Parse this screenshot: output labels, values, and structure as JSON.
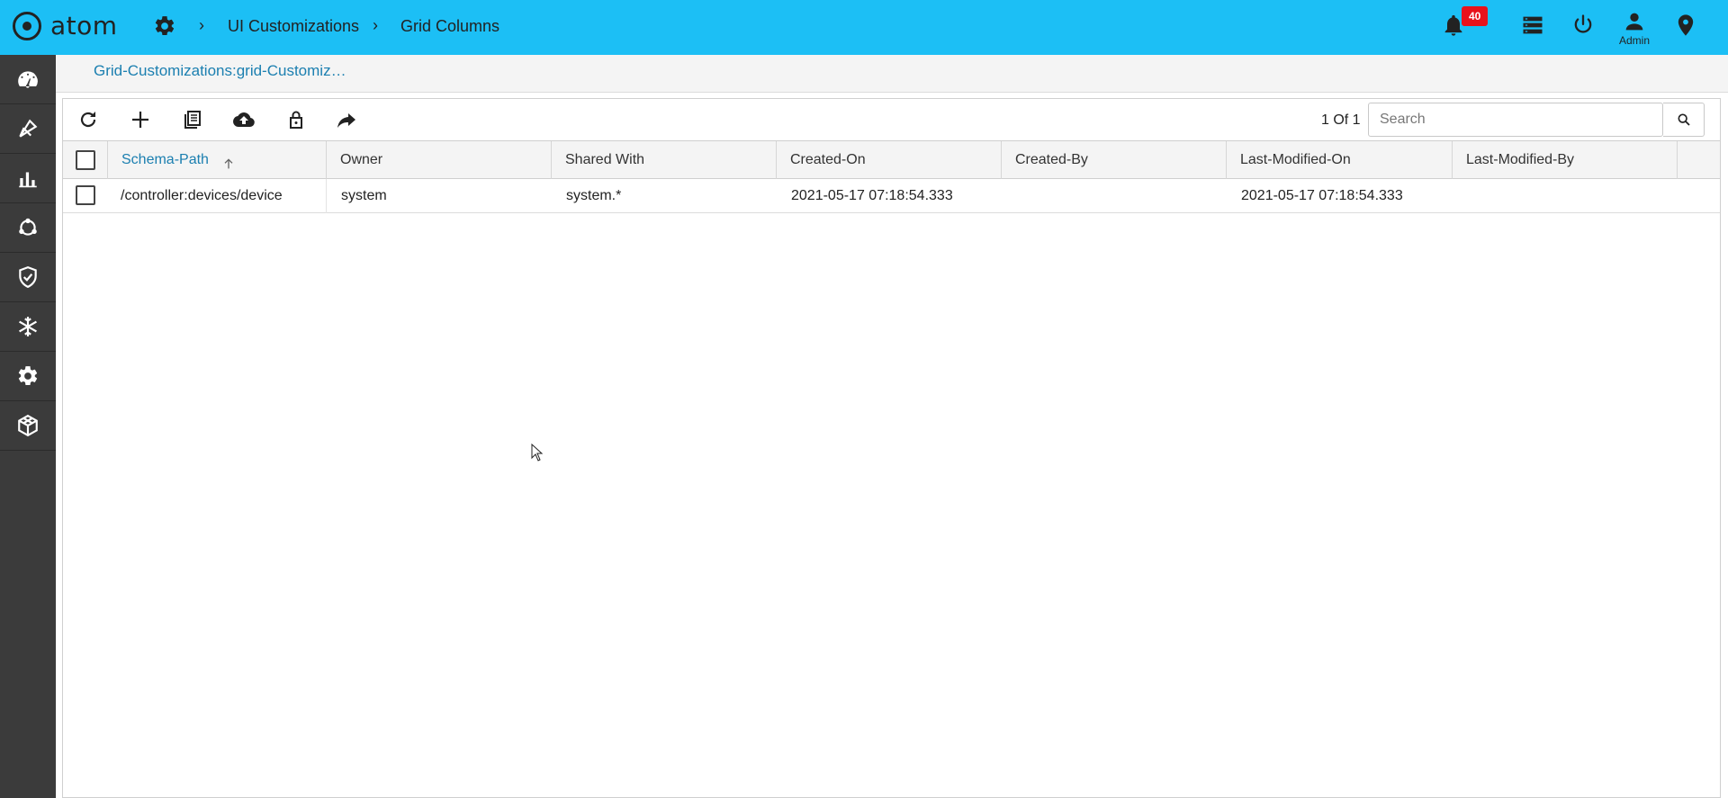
{
  "app": {
    "brand": "atom"
  },
  "breadcrumb": {
    "items": [
      "UI Customizations",
      "Grid Columns"
    ]
  },
  "header": {
    "notification_count": "40",
    "user_label": "Admin"
  },
  "page": {
    "crumb": "Grid-Customizations:grid-Customiz…"
  },
  "toolbar": {
    "pager": "1 Of 1",
    "search_placeholder": "Search"
  },
  "grid": {
    "columns": [
      "Schema-Path",
      "Owner",
      "Shared With",
      "Created-On",
      "Created-By",
      "Last-Modified-On",
      "Last-Modified-By"
    ],
    "rows": [
      {
        "schema_path": "/controller:devices/device",
        "owner": "system",
        "shared_with": "system.*",
        "created_on": "2021-05-17 07:18:54.333",
        "created_by": "",
        "last_modified_on": "2021-05-17 07:18:54.333",
        "last_modified_by": ""
      }
    ]
  },
  "colors": {
    "topbar": "#1cbff5",
    "sidebar": "#3b3b3b",
    "accent": "#1b7fb0",
    "badge": "#e8121b"
  }
}
